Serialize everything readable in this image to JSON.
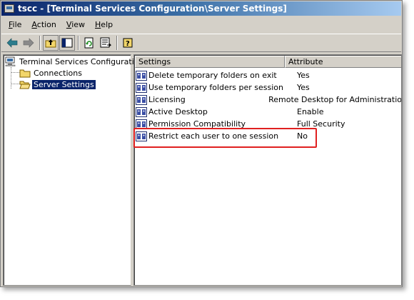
{
  "window": {
    "title": "tscc - [Terminal Services Configuration\\Server Settings]"
  },
  "menubar": {
    "items": [
      "File",
      "Action",
      "View",
      "Help"
    ]
  },
  "toolbar": {
    "buttons": [
      "back-icon",
      "forward-icon",
      "up-folder-icon",
      "show-hide-tree-icon",
      "refresh-icon",
      "export-list-icon",
      "help-icon"
    ]
  },
  "tree": {
    "root": "Terminal Services Configuration",
    "children": [
      "Connections",
      "Server Settings"
    ],
    "selected": "Server Settings"
  },
  "list": {
    "columns": [
      "Settings",
      "Attribute"
    ],
    "rows": [
      {
        "setting": "Delete temporary folders on exit",
        "attribute": "Yes"
      },
      {
        "setting": "Use temporary folders per session",
        "attribute": "Yes"
      },
      {
        "setting": "Licensing",
        "attribute": "Remote Desktop for Administration"
      },
      {
        "setting": "Active Desktop",
        "attribute": "Enable"
      },
      {
        "setting": "Permission Compatibility",
        "attribute": "Full Security"
      },
      {
        "setting": "Restrict each user to one session",
        "attribute": "No"
      }
    ],
    "highlighted_row": 5
  },
  "colors": {
    "title_gradient_start": "#0a246a",
    "title_gradient_end": "#a6caf0",
    "highlight_box": "#e02020",
    "selection": "#0a246a"
  }
}
